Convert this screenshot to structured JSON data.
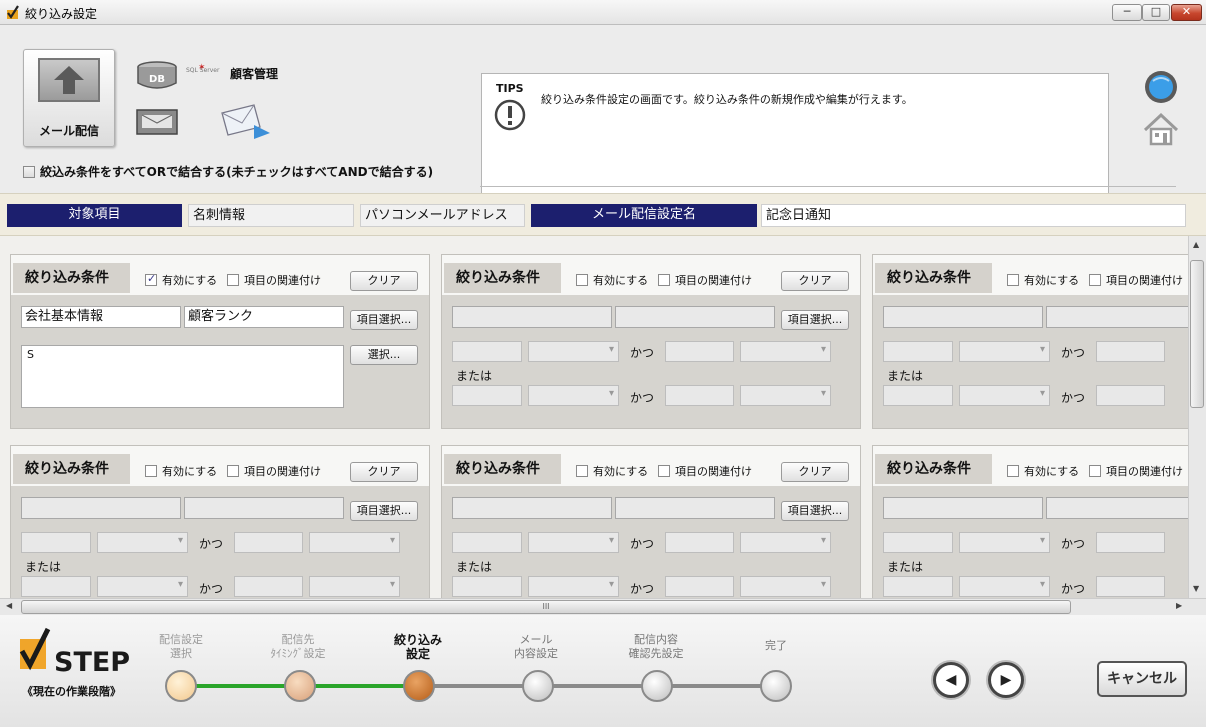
{
  "window": {
    "title": "絞り込み設定",
    "min": "─",
    "max": "□",
    "close": "✕"
  },
  "header": {
    "mail_button": "メール配信",
    "db_label": "DB",
    "sql_logo": "SQL Server",
    "customer": "顧客管理",
    "or_option": "絞込み条件をすべてORで結合する(未チェックはすべてANDで結合する)"
  },
  "tips": {
    "label": "TIPS",
    "message": "絞り込み条件設定の画面です。絞り込み条件の新規作成や編集が行えます。"
  },
  "info": {
    "target_label": "対象項目",
    "target_value1": "名刺情報",
    "target_value2": "パソコンメールアドレス",
    "setting_label": "メール配信設定名",
    "setting_value": "記念日通知"
  },
  "panel_labels": {
    "title": "絞り込み条件",
    "enable": "有効にする",
    "link": "項目の関連付け",
    "clear": "クリア",
    "select_item": "項目選択...",
    "select": "選択...",
    "and": "かつ",
    "or": "または"
  },
  "panels": [
    {
      "enabled": true,
      "field1": "会社基本情報",
      "field2": "顧客ランク",
      "value": "S"
    }
  ],
  "scroll": {
    "grip": "III"
  },
  "steps": {
    "logo": "STEP",
    "sub": "《現在の作業段階》",
    "items": [
      {
        "l1": "配信設定",
        "l2": "選択"
      },
      {
        "l1": "配信先",
        "l2": "ﾀｲﾐﾝｸﾞ設定"
      },
      {
        "l1": "絞り込み",
        "l2": "設定"
      },
      {
        "l1": "メール",
        "l2": "内容設定"
      },
      {
        "l1": "配信内容",
        "l2": "確認先設定"
      },
      {
        "l1": "完了",
        "l2": ""
      }
    ],
    "current_index": 2
  },
  "nav": {
    "prev": "◀",
    "next": "▶",
    "cancel": "キャンセル"
  },
  "colors": {
    "navy": "#1c1f6e",
    "done_track": "#2aa52a",
    "current_dot": "#c06a20"
  }
}
